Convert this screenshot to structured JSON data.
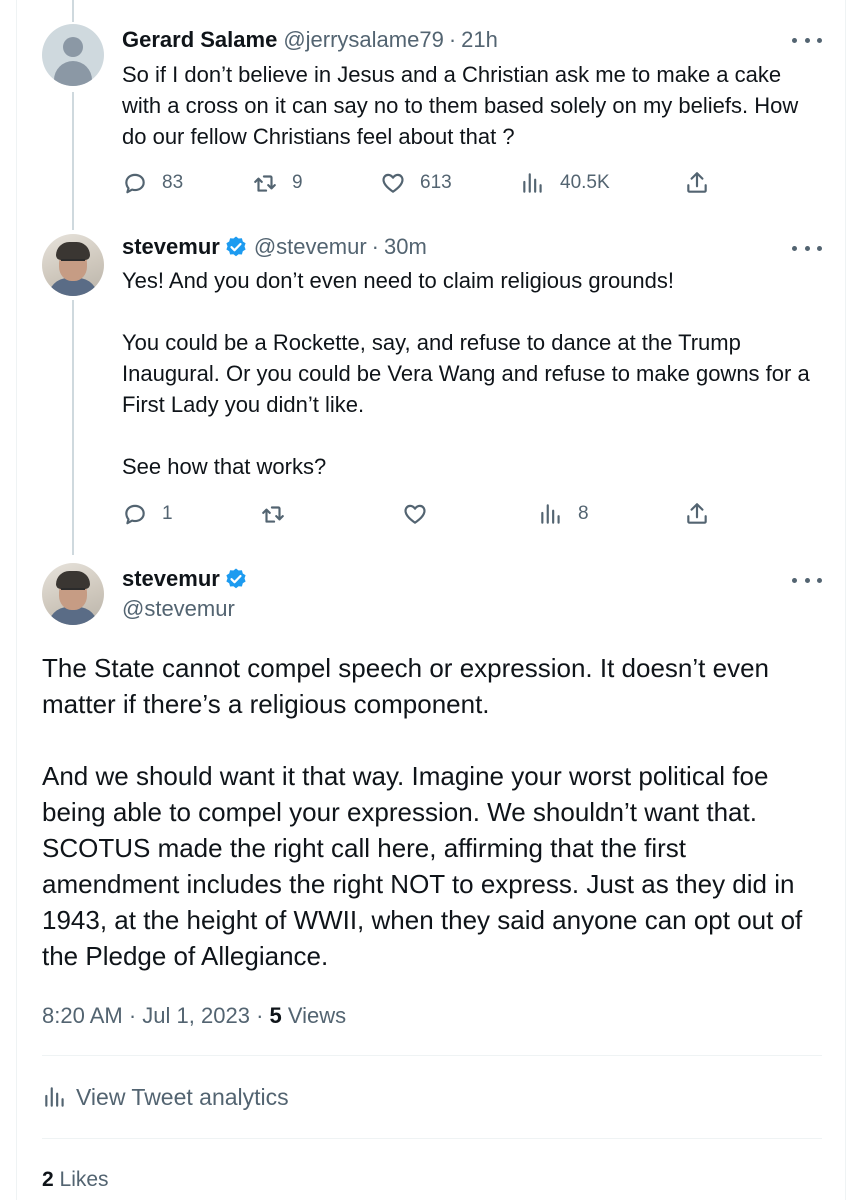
{
  "replies": [
    {
      "name": "Gerard Salame",
      "handle": "@jerrysalame79",
      "time": "21h",
      "verified": false,
      "text": [
        "So if I don’t believe in Jesus and a Christian ask me to make a cake with a cross on it can say no to them based  solely on my beliefs. How do our fellow Christians feel about that ?"
      ],
      "stats": {
        "replies": "83",
        "retweets": "9",
        "likes": "613",
        "views": "40.5K"
      }
    },
    {
      "name": "stevemur",
      "handle": "@stevemur",
      "time": "30m",
      "verified": true,
      "text": [
        "Yes! And you don’t even need to claim religious grounds!",
        "You could be a Rockette, say, and refuse to dance at the Trump Inaugural. Or you could be Vera Wang and refuse to make gowns for a First Lady you didn’t like.",
        "See how that works?"
      ],
      "stats": {
        "replies": "1",
        "retweets": "",
        "likes": "",
        "views": "8"
      }
    }
  ],
  "main_tweet": {
    "name": "stevemur",
    "handle": "@stevemur",
    "verified": true,
    "text": [
      "The State cannot compel speech or expression. It doesn’t even matter if there’s a religious component.",
      "And we should want it that way. Imagine your worst political foe being able to compel your expression. We shouldn’t want that. SCOTUS made the right call here, affirming that the first amendment includes the right NOT to express. Just as they did in 1943, at the height of WWII, when they said anyone can opt out of the Pledge of Allegiance."
    ],
    "time": "8:20 AM",
    "date": "Jul 1, 2023",
    "views_count": "5",
    "views_label": "Views",
    "analytics_label": "View Tweet analytics",
    "likes_count": "2",
    "likes_label": "Likes"
  },
  "separator": "·",
  "icons": {
    "more": "more-horizontal-icon",
    "reply": "reply-icon",
    "retweet": "retweet-icon",
    "like": "heart-icon",
    "views": "views-chart-icon",
    "share": "share-icon",
    "verified": "verified-badge-icon"
  },
  "colors": {
    "verified": "#1d9bf0",
    "muted": "#536471",
    "text": "#0f1419",
    "thread_line": "#cfd9de"
  }
}
